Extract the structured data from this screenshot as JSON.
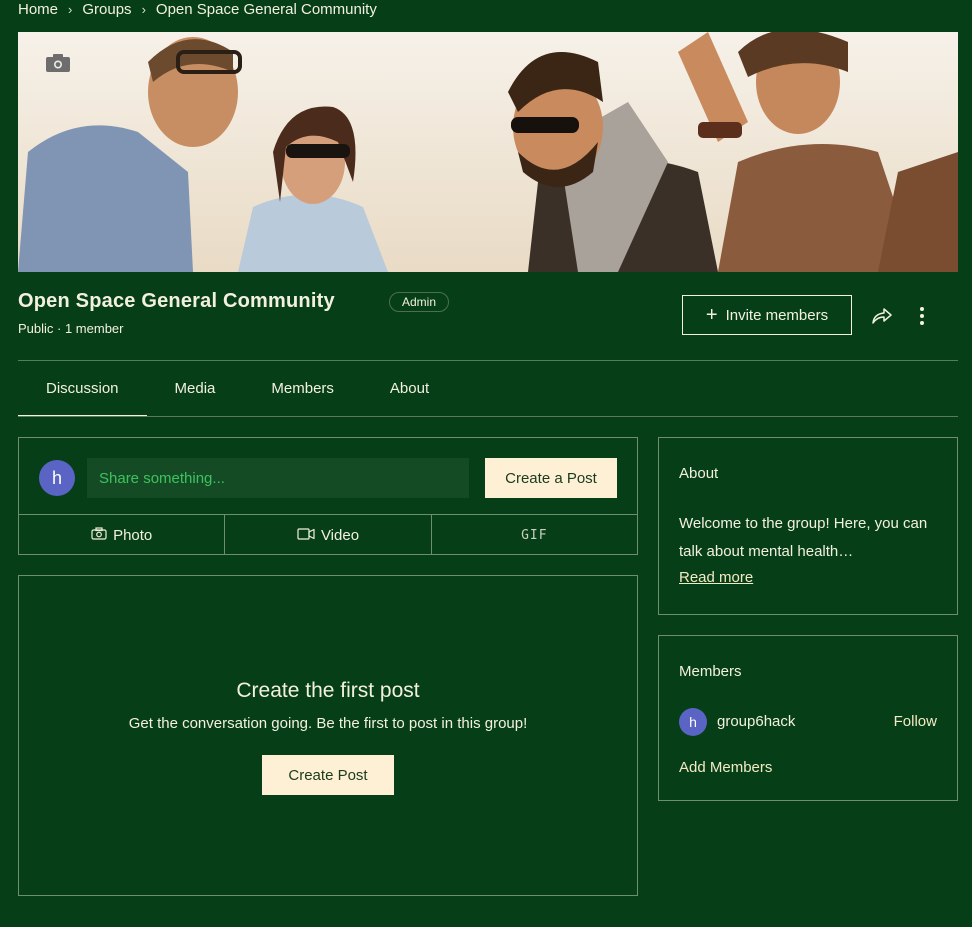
{
  "breadcrumb": {
    "home": "Home",
    "groups": "Groups",
    "current": "Open Space General Community"
  },
  "group": {
    "title": "Open Space General Community",
    "badge": "Admin",
    "meta": "Public · 1 member",
    "invite_label": "Invite members"
  },
  "tabs": [
    "Discussion",
    "Media",
    "Members",
    "About"
  ],
  "composer": {
    "avatar_initial": "h",
    "placeholder": "Share something...",
    "create_label": "Create a Post",
    "photo_label": "Photo",
    "video_label": "Video",
    "gif_label": "GIF"
  },
  "empty_state": {
    "title": "Create the first post",
    "subtitle": "Get the conversation going. Be the first to post in this group!",
    "button": "Create Post"
  },
  "about": {
    "title": "About",
    "text": "Welcome to the group! Here, you can talk about mental health…",
    "read_more": "Read more"
  },
  "members": {
    "title": "Members",
    "member_initial": "h",
    "member_name": "group6hack",
    "follow": "Follow",
    "add_members": "Add Members"
  },
  "colors": {
    "background": "#063f17",
    "text": "#f3f0e0",
    "button_bg": "#fdf0d5",
    "avatar": "#5a64c4",
    "input_bg": "#144b25"
  }
}
